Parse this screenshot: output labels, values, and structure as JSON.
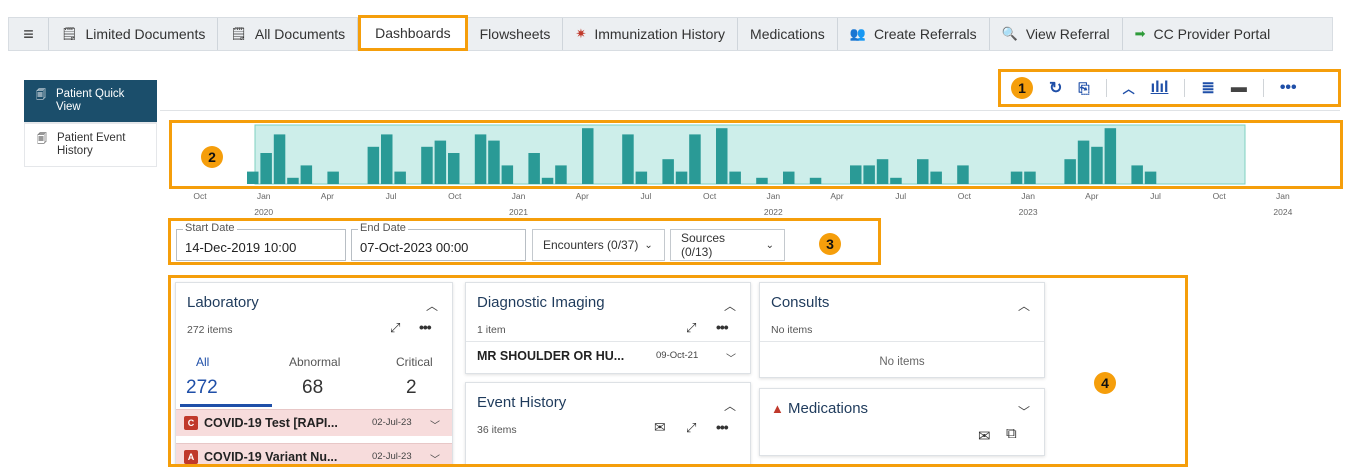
{
  "tabs": [
    {
      "label": "Limited Documents",
      "icon": "document-icon"
    },
    {
      "label": "All Documents",
      "icon": "document-icon"
    },
    {
      "label": "Dashboards",
      "icon": ""
    },
    {
      "label": "Flowsheets",
      "icon": ""
    },
    {
      "label": "Immunization History",
      "icon": "immunization-icon"
    },
    {
      "label": "Medications",
      "icon": ""
    },
    {
      "label": "Create Referrals",
      "icon": "referral-icon"
    },
    {
      "label": "View Referral",
      "icon": "search-icon"
    },
    {
      "label": "CC Provider Portal",
      "icon": "arrow-right-icon"
    }
  ],
  "active_tab": "Dashboards",
  "sidebar": {
    "items": [
      {
        "label": "Patient Quick View",
        "active": true
      },
      {
        "label": "Patient Event History",
        "active": false
      }
    ]
  },
  "callouts": {
    "toolbar": "1",
    "timeline": "2",
    "filters": "3",
    "panels": "4"
  },
  "timeline": {
    "year_labels": [
      "2020",
      "2021",
      "2022",
      "2023",
      "2024"
    ],
    "month_labels": [
      "Oct",
      "Jan",
      "Apr",
      "Jul",
      "Oct",
      "Jan",
      "Apr",
      "Jul",
      "Oct",
      "Jan",
      "Apr",
      "Jul",
      "Oct",
      "Jan",
      "Apr",
      "Jul",
      "Oct",
      "Jan"
    ],
    "bar_heights": [
      2,
      5,
      8,
      1,
      3,
      0,
      2,
      0,
      0,
      6,
      8,
      2,
      0,
      6,
      7,
      5,
      0,
      8,
      7,
      3,
      0,
      5,
      1,
      3,
      0,
      9,
      0,
      0,
      8,
      2,
      0,
      4,
      2,
      8,
      0,
      9,
      2,
      0,
      1,
      0,
      2,
      0,
      1,
      0,
      0,
      3,
      3,
      4,
      1,
      0,
      4,
      2,
      0,
      3,
      0,
      0,
      0,
      2,
      2,
      0,
      0,
      4,
      7,
      6,
      9,
      0,
      3,
      2,
      0,
      0,
      0,
      0,
      0,
      0,
      0,
      0,
      0
    ],
    "colors": {
      "bar": "#2a9a96",
      "range_fill": "#cdeeea",
      "range_border": "#7fd0c0"
    }
  },
  "filters": {
    "start_label": "Start Date",
    "start_value": "14-Dec-2019 10:00",
    "end_label": "End Date",
    "end_value": "07-Oct-2023 00:00",
    "encounters": "Encounters (0/37)",
    "sources": "Sources (0/13)"
  },
  "laboratory": {
    "title": "Laboratory",
    "count": "272 items",
    "stats": [
      {
        "label": "All",
        "value": "272"
      },
      {
        "label": "Abnormal",
        "value": "68"
      },
      {
        "label": "Critical",
        "value": "2"
      }
    ],
    "rows": [
      {
        "tag": "C",
        "text": "COVID-19 Test [RAPI...",
        "date": "02-Jul-23"
      },
      {
        "tag": "A",
        "text": "COVID-19 Variant Nu...",
        "date": "02-Jul-23"
      }
    ]
  },
  "diagnostic": {
    "title": "Diagnostic Imaging",
    "count": "1 item",
    "row": {
      "text": "MR SHOULDER OR HU...",
      "date": "09-Oct-21"
    }
  },
  "event_history": {
    "title": "Event History",
    "count": "36 items"
  },
  "consults": {
    "title": "Consults",
    "count": "No items",
    "empty": "No items"
  },
  "medications": {
    "title": "Medications"
  },
  "colors": {
    "accent": "#f59e0b",
    "brand": "#1b4e6b",
    "link": "#1f4fa8",
    "alert": "#c0392b"
  }
}
